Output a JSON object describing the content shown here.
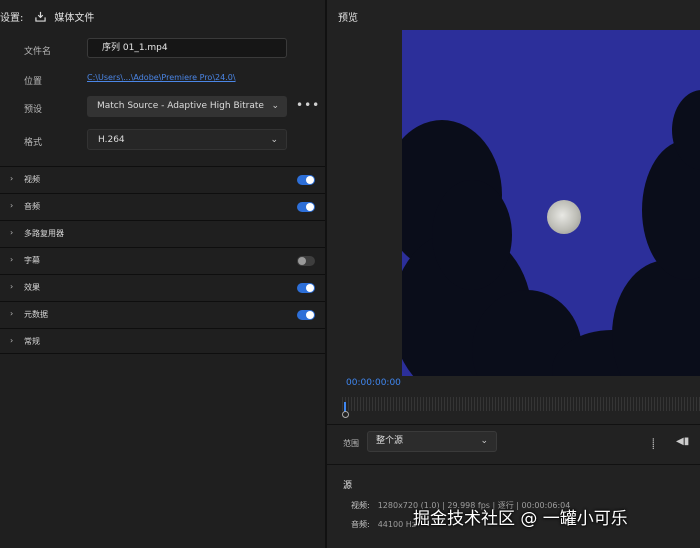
{
  "left": {
    "header": {
      "title": "设置:",
      "media_label": "媒体文件"
    },
    "filename": {
      "label": "文件名",
      "value": "序列 01_1.mp4"
    },
    "location": {
      "label": "位置",
      "value": "C:\\Users\\...\\Adobe\\Premiere Pro\\24.0\\"
    },
    "preset": {
      "label": "预设",
      "value": "Match Source - Adaptive High Bitrate",
      "more": "•••"
    },
    "format": {
      "label": "格式",
      "value": "H.264"
    },
    "sections": [
      {
        "label": "视频",
        "enabled": true
      },
      {
        "label": "音频",
        "enabled": true
      },
      {
        "label": "多路复用器"
      },
      {
        "label": "字幕",
        "enabled": false
      },
      {
        "label": "效果",
        "enabled": true
      },
      {
        "label": "元数据",
        "enabled": true
      },
      {
        "label": "常规"
      }
    ]
  },
  "preview": {
    "title": "预览",
    "timecode": "00:00:00:00",
    "range_label": "范围",
    "range_value": "整个源"
  },
  "source": {
    "title": "源",
    "video_label": "视频:",
    "video_value": "1280x720 (1.0) | 29.998 fps | 逐行 | 00:00:06:04",
    "audio_label": "音频:",
    "audio_value": "44100 Hz"
  },
  "watermark": "掘金技术社区 @ 一罐小可乐",
  "colors": {
    "accent": "#3f86ef",
    "link": "#4b86e6",
    "sky": "#2c2f9a"
  }
}
